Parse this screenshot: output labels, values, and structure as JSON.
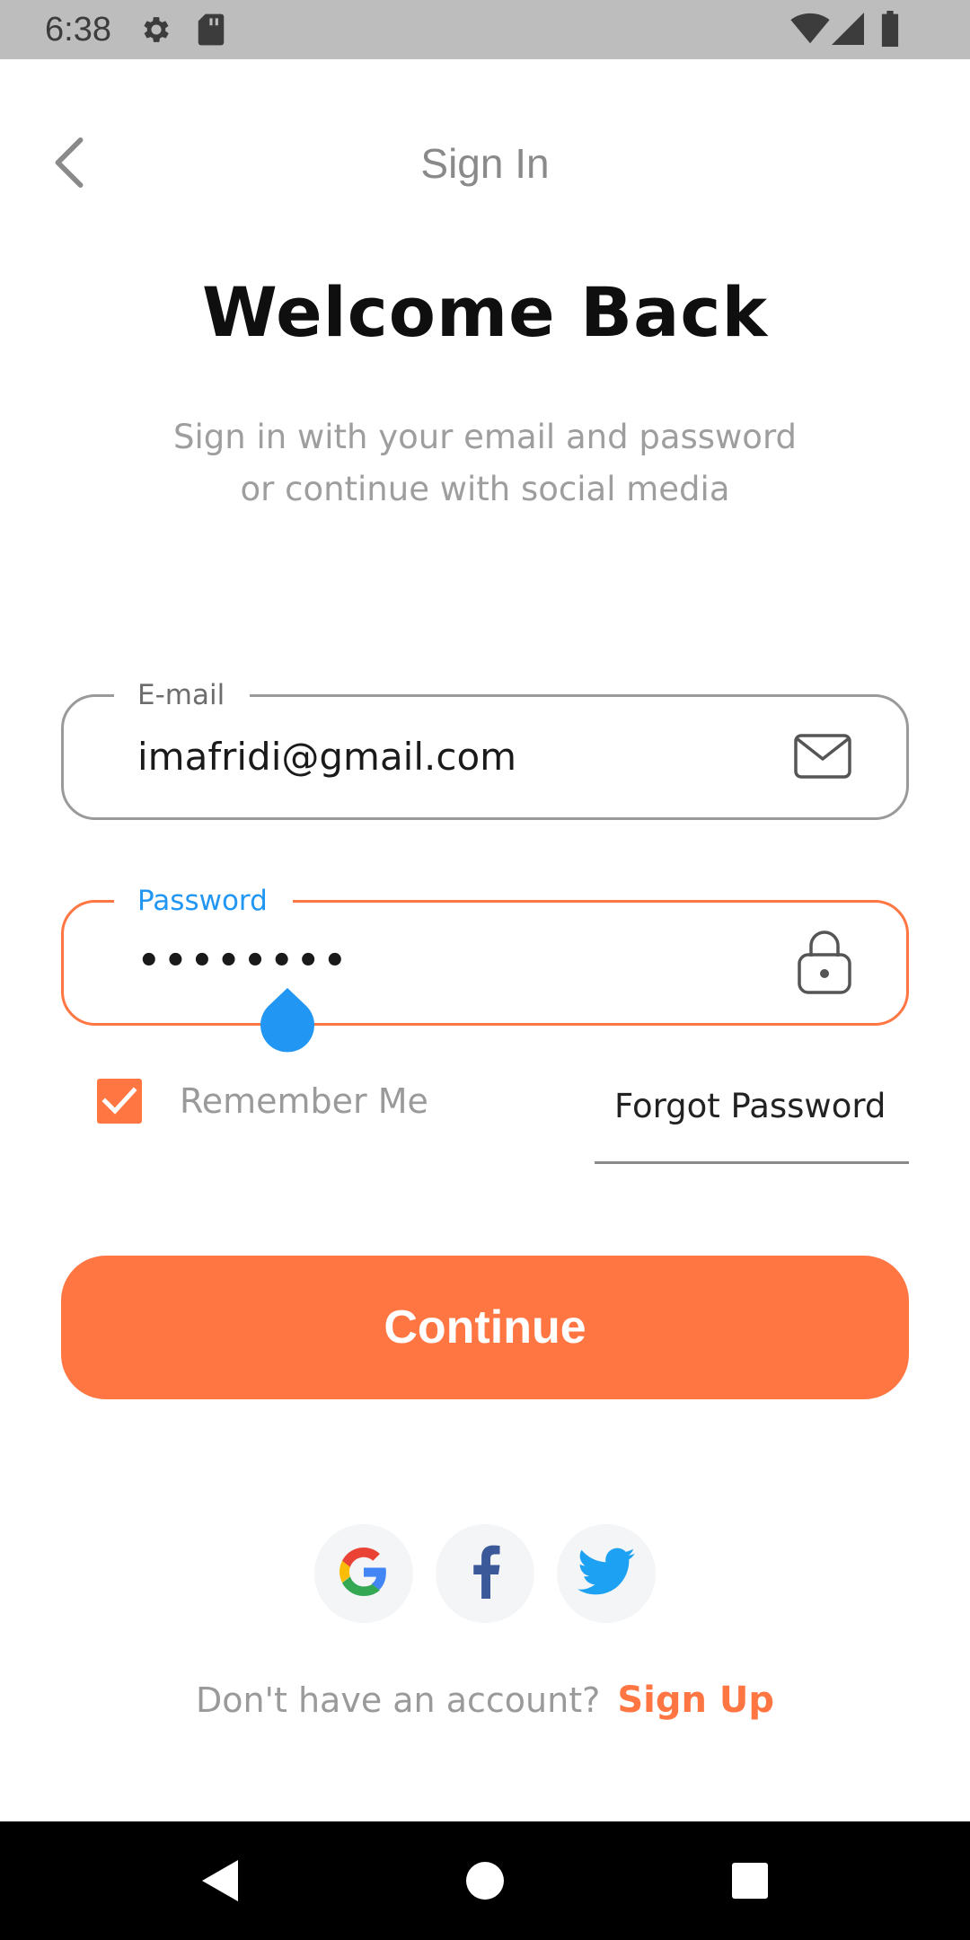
{
  "status_bar": {
    "time": "6:38",
    "left_icons": [
      "settings-icon",
      "sd-card-icon"
    ],
    "right_icons": [
      "wifi-icon",
      "cell-signal-icon",
      "battery-icon"
    ]
  },
  "header": {
    "back_icon": "chevron-left-icon",
    "title": "Sign In"
  },
  "welcome": {
    "heading": "Welcome Back",
    "subtitle_line1": "Sign in with your email and password",
    "subtitle_line2": "or continue with social media"
  },
  "form": {
    "email": {
      "label": "E-mail",
      "value": "imafridi@gmail.com",
      "icon": "mail-icon"
    },
    "password": {
      "label": "Password",
      "value": "••••••••",
      "icon": "lock-icon",
      "focused": true
    },
    "remember_me": {
      "label": "Remember Me",
      "checked": true
    },
    "forgot_password": "Forgot Password"
  },
  "continue_button": "Continue",
  "social": [
    "google-icon",
    "facebook-icon",
    "twitter-icon"
  ],
  "signup": {
    "question": "Don't have an account?",
    "link": "Sign Up"
  },
  "colors": {
    "accent": "#ff7643",
    "focus_label": "#2196f3",
    "status_bar": "#bdbdbd",
    "nav_bar": "#000000"
  }
}
